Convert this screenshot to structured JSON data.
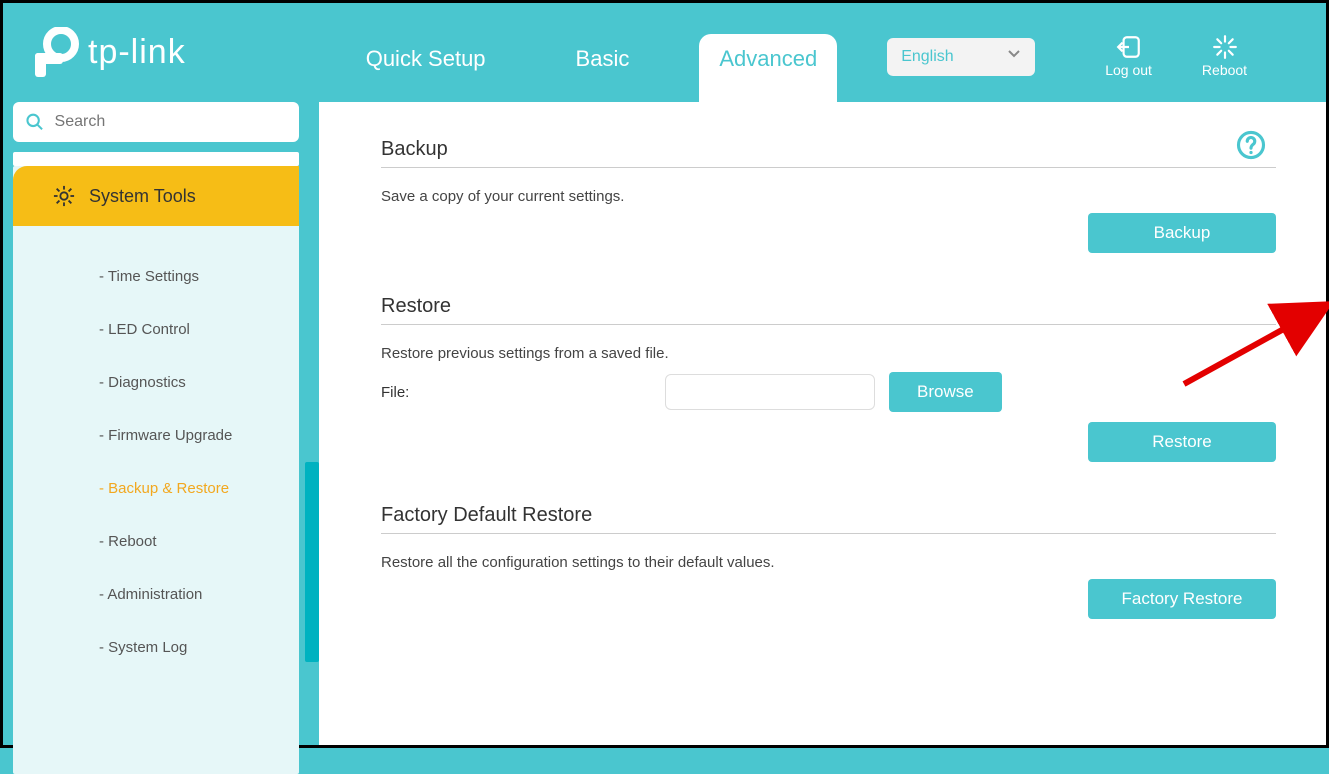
{
  "brand": "tp-link",
  "tabs": {
    "quick": "Quick Setup",
    "basic": "Basic",
    "advanced": "Advanced"
  },
  "language": "English",
  "header_actions": {
    "logout": "Log out",
    "reboot": "Reboot"
  },
  "search": {
    "placeholder": "Search"
  },
  "sidebar": {
    "header": "System Tools",
    "items": [
      "- Time Settings",
      "- LED Control",
      "- Diagnostics",
      "- Firmware Upgrade",
      "- Backup & Restore",
      "- Reboot",
      "- Administration",
      "- System Log"
    ],
    "active_index": 4
  },
  "sections": {
    "backup": {
      "title": "Backup",
      "desc": "Save a copy of your current settings.",
      "button": "Backup"
    },
    "restore": {
      "title": "Restore",
      "desc": "Restore previous settings from a saved file.",
      "file_label": "File:",
      "browse": "Browse",
      "button": "Restore"
    },
    "factory": {
      "title": "Factory Default Restore",
      "desc": "Restore all the configuration settings to their default values.",
      "button": "Factory Restore"
    }
  }
}
